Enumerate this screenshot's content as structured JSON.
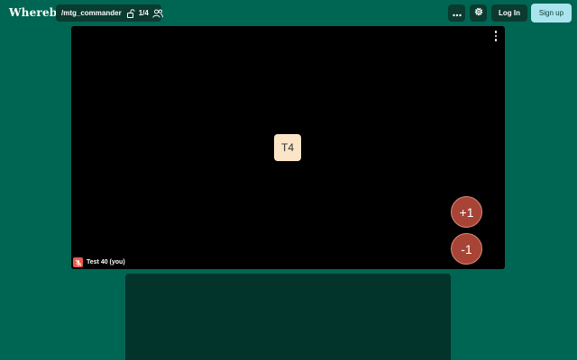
{
  "header": {
    "logo": "Whereby",
    "room_name": "/mtg_commander",
    "participant_count": "1/4",
    "lock_icon": "unlocked-lock-icon",
    "people_icon": "people-icon"
  },
  "toolbar": {
    "more_icon": "more-horizontal-icon",
    "settings_icon": "gear-icon",
    "login_label": "Log In",
    "signup_label": "Sign up"
  },
  "video": {
    "avatar_initials": "T4",
    "participant_label": "Test 40 (you)",
    "mic_icon": "mic-off-icon",
    "tile_menu_icon": "more-vertical-icon"
  },
  "counters": {
    "plus_label": "+1",
    "minus_label": "-1"
  },
  "colors": {
    "background": "#006654",
    "dark": "#0b3a2f",
    "signup_bg": "#a9e4ef",
    "counter_bg": "#a84435",
    "avatar_bg": "#fbe5c7",
    "mic_off_bg": "#e85a4f"
  }
}
